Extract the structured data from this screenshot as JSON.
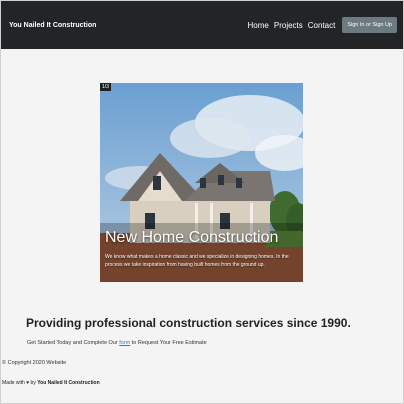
{
  "nav": {
    "brand": "You Nailed It Construction",
    "links": [
      "Home",
      "Projects",
      "Contact"
    ],
    "cta_label": "Sign In or Sign Up"
  },
  "hero": {
    "badge": "1/3",
    "title": "New Home Construction",
    "description": "We know what makes a home classic and we specialize in designing homes. In the process we take inspiration from having built homes from the ground up."
  },
  "main": {
    "headline": "Providing professional construction services since 1990.",
    "cta_prefix": "Get Started Today and Complete Our",
    "cta_link": "form",
    "cta_suffix": "to Request Your Free Estimate"
  },
  "footer": {
    "copyright_symbol": "©",
    "copyright_text": "Copyright 2020 Website",
    "made_prefix": "Made with",
    "made_heart": "♥",
    "made_by": "by",
    "made_company": "You Nailed It Construction"
  },
  "colors": {
    "nav_bg": "#222426",
    "page_bg": "#f4f4f4",
    "button_bg": "#6e7a82",
    "link": "#2f7dd1"
  }
}
